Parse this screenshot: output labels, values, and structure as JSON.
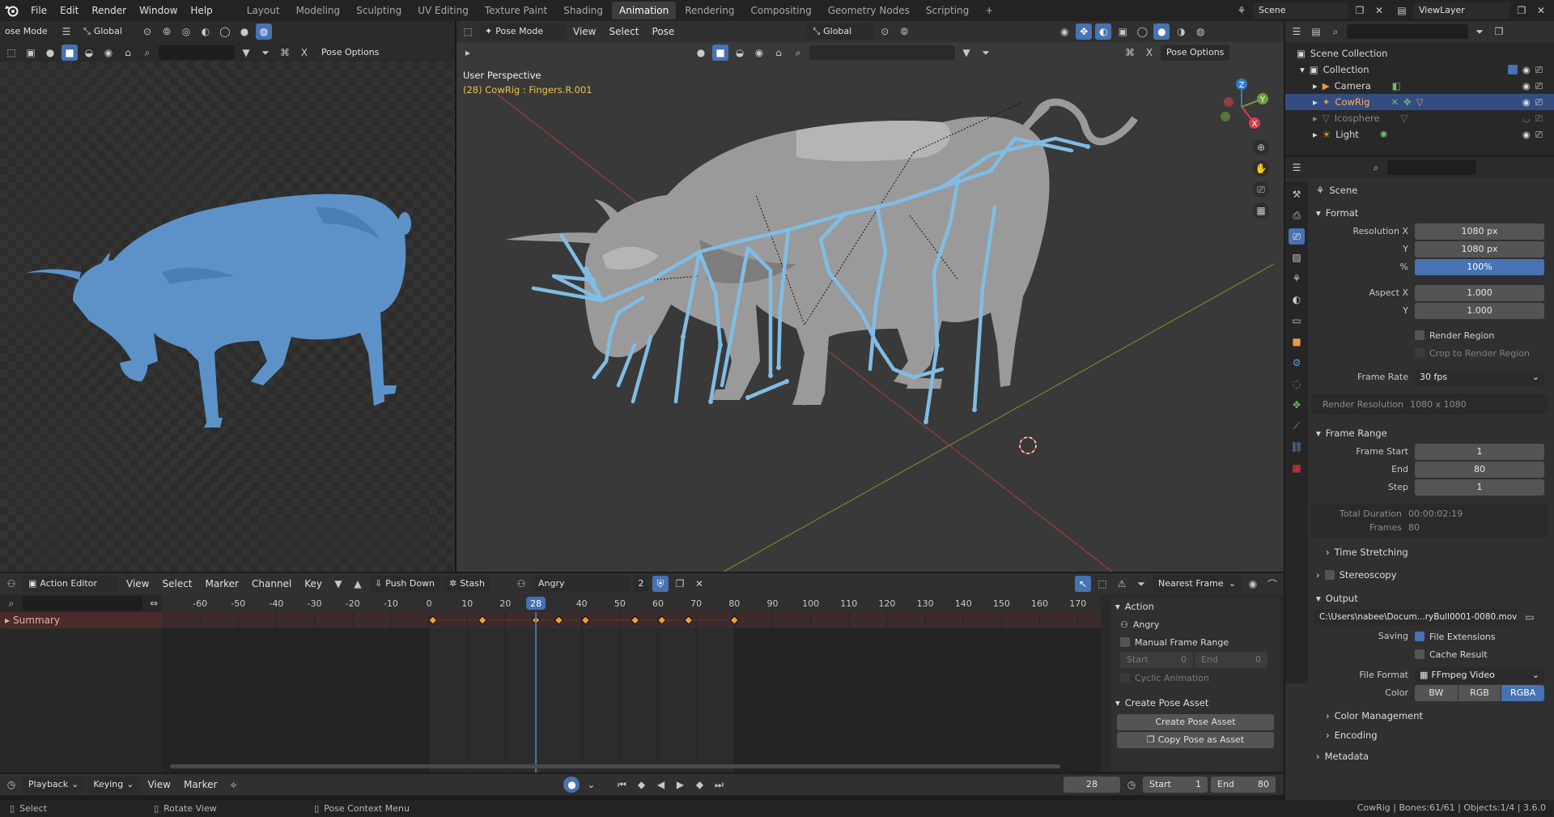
{
  "topbar": {
    "menus": [
      "File",
      "Edit",
      "Render",
      "Window",
      "Help"
    ],
    "workspaces": [
      "Layout",
      "Modeling",
      "Sculpting",
      "UV Editing",
      "Texture Paint",
      "Shading",
      "Animation",
      "Rendering",
      "Compositing",
      "Geometry Nodes",
      "Scripting"
    ],
    "active_workspace": "Animation",
    "add_tab": "+",
    "scene": "Scene",
    "view_layer": "ViewLayer"
  },
  "left_view": {
    "mode": "ose Mode",
    "orientation": "Global",
    "pose_options": "Pose Options"
  },
  "viewport": {
    "mode": "Pose Mode",
    "menus": [
      "View",
      "Select",
      "Pose"
    ],
    "orientation": "Global",
    "pose_options": "Pose Options",
    "title": "User Perspective",
    "subtitle": "(28) CowRig : Fingers.R.001",
    "gizmo_axes": [
      "Z",
      "Y",
      "X"
    ]
  },
  "outliner": {
    "root": "Scene Collection",
    "collection": "Collection",
    "items": [
      {
        "label": "Camera",
        "active": false,
        "muted": false
      },
      {
        "label": "CowRig",
        "active": true,
        "muted": false
      },
      {
        "label": "Icosphere",
        "active": false,
        "muted": true
      },
      {
        "label": "Light",
        "active": false,
        "muted": false
      }
    ]
  },
  "properties": {
    "scene_label": "Scene",
    "format": {
      "title": "Format",
      "resolution_x_label": "Resolution X",
      "resolution_x": "1080 px",
      "resolution_y_label": "Y",
      "resolution_y": "1080 px",
      "percent_label": "%",
      "percent": "100%",
      "percent_level": 1.0,
      "aspect_x_label": "Aspect X",
      "aspect_x": "1.000",
      "aspect_y_label": "Y",
      "aspect_y": "1.000",
      "render_region": "Render Region",
      "crop_region": "Crop to Render Region",
      "frame_rate_label": "Frame Rate",
      "frame_rate": "30 fps",
      "render_resolution_label": "Render Resolution",
      "render_resolution": "1080 x 1080"
    },
    "frame_range": {
      "title": "Frame Range",
      "start_label": "Frame Start",
      "start": "1",
      "end_label": "End",
      "end": "80",
      "step_label": "Step",
      "step": "1",
      "duration_label": "Total Duration",
      "duration": "00:00:02:19",
      "frames_label": "Frames",
      "frames": "80"
    },
    "time_stretching": "Time Stretching",
    "stereoscopy": "Stereoscopy",
    "output": {
      "title": "Output",
      "path": "C:\\Users\\nabee\\Docum...ryBull0001-0080.mov",
      "saving_label": "Saving",
      "file_extensions": "File Extensions",
      "cache_result": "Cache Result",
      "file_format_label": "File Format",
      "file_format": "FFmpeg Video",
      "color_label": "Color",
      "color_modes": [
        "BW",
        "RGB",
        "RGBA"
      ],
      "color_active": "RGBA"
    },
    "color_management": "Color Management",
    "encoding": "Encoding",
    "metadata": "Metadata"
  },
  "action_editor": {
    "editor": "Action Editor",
    "menus": [
      "View",
      "Select",
      "Marker",
      "Channel",
      "Key"
    ],
    "push_down": "Push Down",
    "stash": "Stash",
    "action": "Angry",
    "users": "2",
    "snap": "Nearest Frame",
    "summary": "Summary",
    "current_frame": 28,
    "view_range": [
      -70,
      176
    ],
    "ticks": [
      -60,
      -50,
      -40,
      -30,
      -20,
      -10,
      0,
      10,
      20,
      40,
      50,
      60,
      70,
      80,
      90,
      100,
      110,
      120,
      130,
      140,
      150,
      160,
      170
    ],
    "keyframes": [
      1,
      14,
      28,
      34,
      41,
      54,
      61,
      68,
      80
    ],
    "sidebar": {
      "action_title": "Action",
      "action_name": "Angry",
      "manual_range": "Manual Frame Range",
      "start_label": "Start",
      "start": "0",
      "end_label": "End",
      "end": "0",
      "cyclic": "Cyclic Animation",
      "pose_title": "Create Pose Asset",
      "create_pose": "Create Pose Asset",
      "copy_pose": "Copy Pose as Asset"
    }
  },
  "timeline": {
    "menus": [
      "Playback",
      "Keying",
      "View",
      "Marker"
    ],
    "current_frame": "28",
    "start_label": "Start",
    "start": "1",
    "end_label": "End",
    "end": "80"
  },
  "statusbar": {
    "left": [
      "Select",
      "Rotate View",
      "Pose Context Menu"
    ],
    "right": "CowRig | Bones:61/61 | Objects:1/4 | 3.6.0"
  },
  "colors": {
    "accent": "#4772b3",
    "bone": "#7fbde4",
    "cow_left": "#5c92c8",
    "keyframe": "#f0a030",
    "playhead": "#4772b3",
    "subtitle": "#e8c450"
  }
}
